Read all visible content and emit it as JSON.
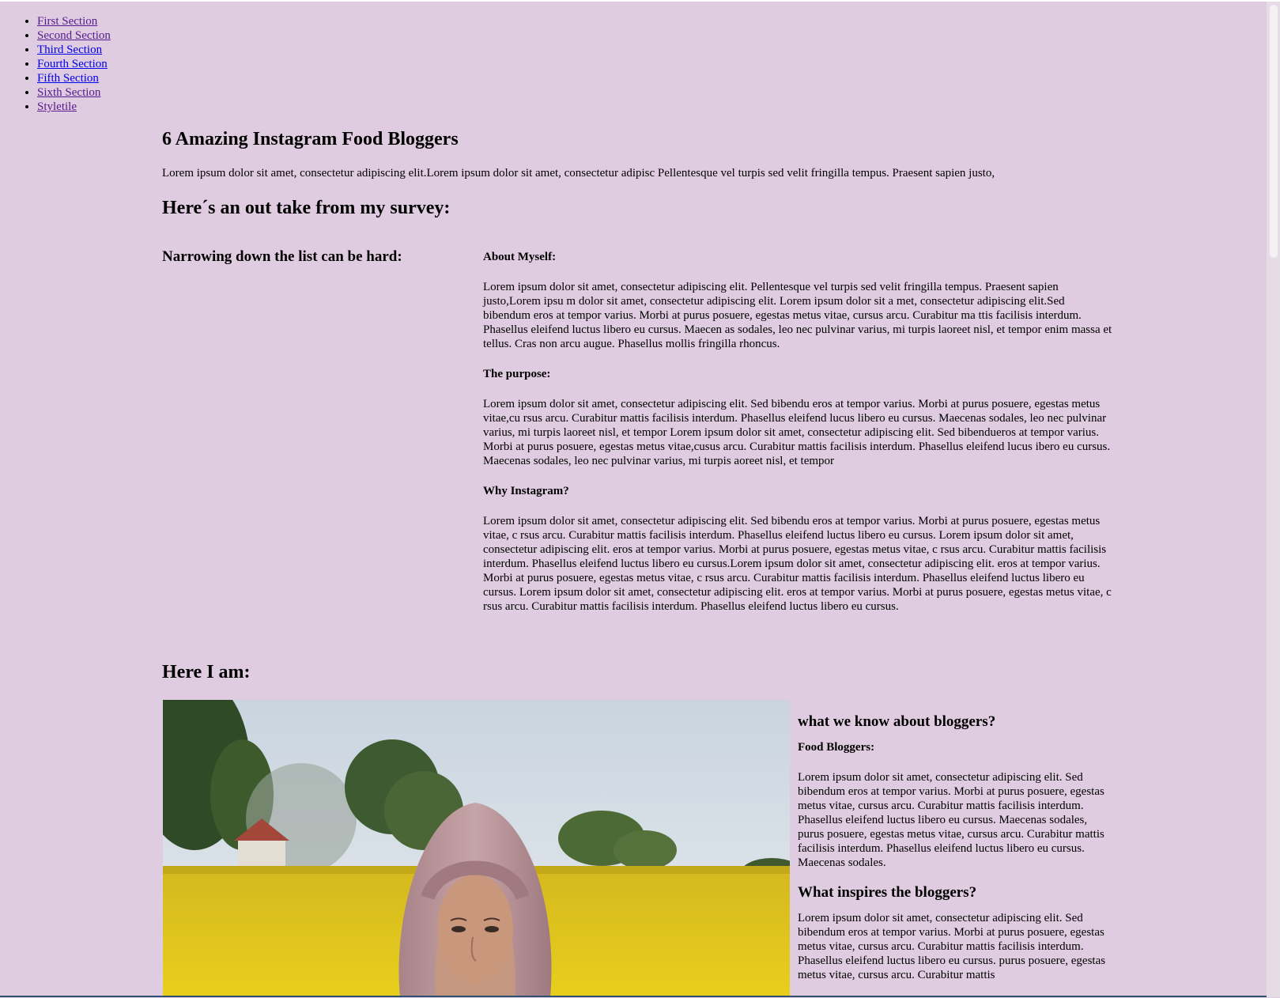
{
  "nav": {
    "items": [
      {
        "label": "First Section"
      },
      {
        "label": "Second Section"
      },
      {
        "label": "Third Section"
      },
      {
        "label": "Fourth Section"
      },
      {
        "label": "Fifth Section"
      },
      {
        "label": "Sixth Section"
      },
      {
        "label": "Styletile"
      }
    ]
  },
  "main": {
    "title": "6 Amazing Instagram Food Bloggers",
    "intro": "Lorem ipsum dolor sit amet, consectetur adipiscing elit.Lorem ipsum dolor sit amet, consectetur adipisc Pellentesque vel turpis sed velit fringilla tempus. Praesent sapien justo,",
    "survey_title": "Here´s an out take from my survey:",
    "narrow_heading": "Narrowing down the list can be hard:"
  },
  "survey": {
    "about_heading": "About Myself:",
    "about_text": "Lorem ipsum dolor sit amet, consectetur adipiscing elit. Pellentesque vel turpis sed velit fringilla tempus. Praesent sapien justo,Lorem ipsu m dolor sit amet, consectetur adipiscing elit. Lorem ipsum dolor sit a met, consectetur adipiscing elit.Sed bibendum eros at tempor varius. Morbi at purus posuere, egestas metus vitae, cursus arcu. Curabitur ma ttis facilisis interdum. Phasellus eleifend luctus libero eu cursus. Maecen as sodales, leo nec pulvinar varius, mi turpis laoreet nisl, et tempor enim massa et tellus. Cras non arcu augue. Phasellus mollis fringilla rhoncus.",
    "purpose_heading": "The purpose:",
    "purpose_text": "Lorem ipsum dolor sit amet, consectetur adipiscing elit. Sed bibendu eros at tempor varius. Morbi at purus posuere, egestas metus vitae,cu rsus arcu. Curabitur mattis facilisis interdum. Phasellus eleifend lucus libero eu cursus. Maecenas sodales, leo nec pulvinar varius, mi turpis laoreet nisl, et tempor Lorem ipsum dolor sit amet, consectetur adipiscing elit. Sed bibendueros at tempor varius. Morbi at purus posuere, egestas metus vitae,cusus arcu. Curabitur mattis facilisis interdum. Phasellus eleifend lucus ibero eu cursus. Maecenas sodales, leo nec pulvinar varius, mi turpis aoreet nisl, et tempor",
    "why_heading": "Why Instagram?",
    "why_text": "Lorem ipsum dolor sit amet, consectetur adipiscing elit. Sed bibendu eros at tempor varius. Morbi at purus posuere, egestas metus vitae, c rsus arcu. Curabitur mattis facilisis interdum. Phasellus eleifend luctus libero eu cursus. Lorem ipsum dolor sit amet, consectetur adipiscing elit. eros at tempor varius. Morbi at purus posuere, egestas metus vitae, c rsus arcu. Curabitur mattis facilisis interdum. Phasellus eleifend luctus libero eu cursus.Lorem ipsum dolor sit amet, consectetur adipiscing elit. eros at tempor varius. Morbi at purus posuere, egestas metus vitae, c rsus arcu. Curabitur mattis facilisis interdum. Phasellus eleifend luctus libero eu cursus. Lorem ipsum dolor sit amet, consectetur adipiscing elit. eros at tempor varius. Morbi at purus posuere, egestas metus vitae, c rsus arcu. Curabitur mattis facilisis interdum. Phasellus eleifend luctus libero eu cursus."
  },
  "here": {
    "heading": "Here I am:"
  },
  "side": {
    "heading": "what we know about bloggers?",
    "food_heading": "Food Bloggers:",
    "food_text": "Lorem ipsum dolor sit amet, consectetur adipiscing elit. Sed bibendum eros at tempor varius. Morbi at purus posuere, egestas metus vitae, cursus arcu. Curabitur mattis facilisis interdum. Phasellus eleifend luctus libero eu cursus. Maecenas sodales, purus posuere, egestas metus vitae, cursus arcu. Curabitur mattis facilisis interdum. Phasellus eleifend luctus libero eu cursus. Maecenas sodales.",
    "inspire_heading": "What inspires the bloggers?",
    "inspire_text": "Lorem ipsum dolor sit amet, consectetur adipiscing elit. Sed bibendum eros at tempor varius. Morbi at purus posuere, egestas metus vitae, cursus arcu. Curabitur mattis facilisis interdum. Phasellus eleifend luctus libero eu cursus. purus posuere, egestas metus vitae, cursus arcu. Curabitur mattis"
  },
  "colors": {
    "background": "#e0cce0",
    "link_visited": "#551a8b",
    "link_unvisited": "#0000ee"
  }
}
